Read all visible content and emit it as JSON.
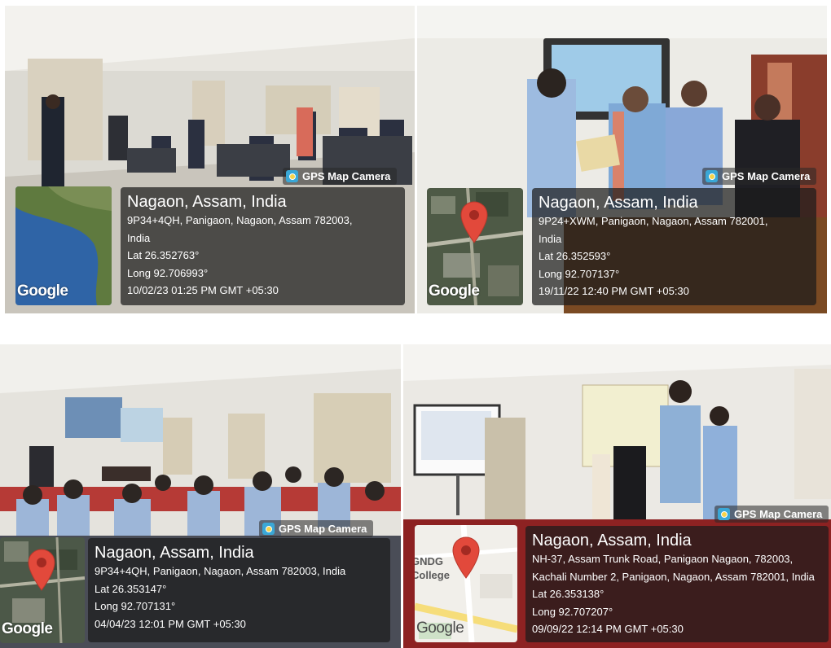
{
  "brand_label": "GPS Map Camera",
  "map_brand": "Google",
  "photos": [
    {
      "city": "Nagaon, Assam, India",
      "address": [
        "9P34+4QH, Panigaon, Nagaon, Assam 782003,",
        "India"
      ],
      "lat": "Lat 26.352763°",
      "long": "Long 92.706993°",
      "datetime": "10/02/23 01:25 PM GMT +05:30"
    },
    {
      "city": "Nagaon, Assam, India",
      "address": [
        "9P24+XWM, Panigaon, Nagaon, Assam 782001,",
        "India"
      ],
      "lat": "Lat 26.352593°",
      "long": "Long 92.707137°",
      "datetime": "19/11/22 12:40 PM GMT +05:30"
    },
    {
      "city": "Nagaon, Assam, India",
      "address": [
        "9P34+4QH, Panigaon, Nagaon, Assam 782003, India"
      ],
      "lat": "Lat 26.353147°",
      "long": "Long 92.707131°",
      "datetime": "04/04/23 12:01 PM GMT +05:30"
    },
    {
      "city": "Nagaon, Assam, India",
      "address": [
        "NH-37, Assam Trunk Road, Panigaon Nagaon, 782003,",
        "Kachali Number 2, Panigaon, Nagaon, Assam 782001, India"
      ],
      "lat": "Lat 26.353138°",
      "long": "Long 92.707207°",
      "datetime": "09/09/22 12:14 PM GMT +05:30"
    }
  ],
  "map4_label": "GNDG College",
  "colors": {
    "overlay": "#1c1c1c",
    "pin": "#e2493b"
  }
}
